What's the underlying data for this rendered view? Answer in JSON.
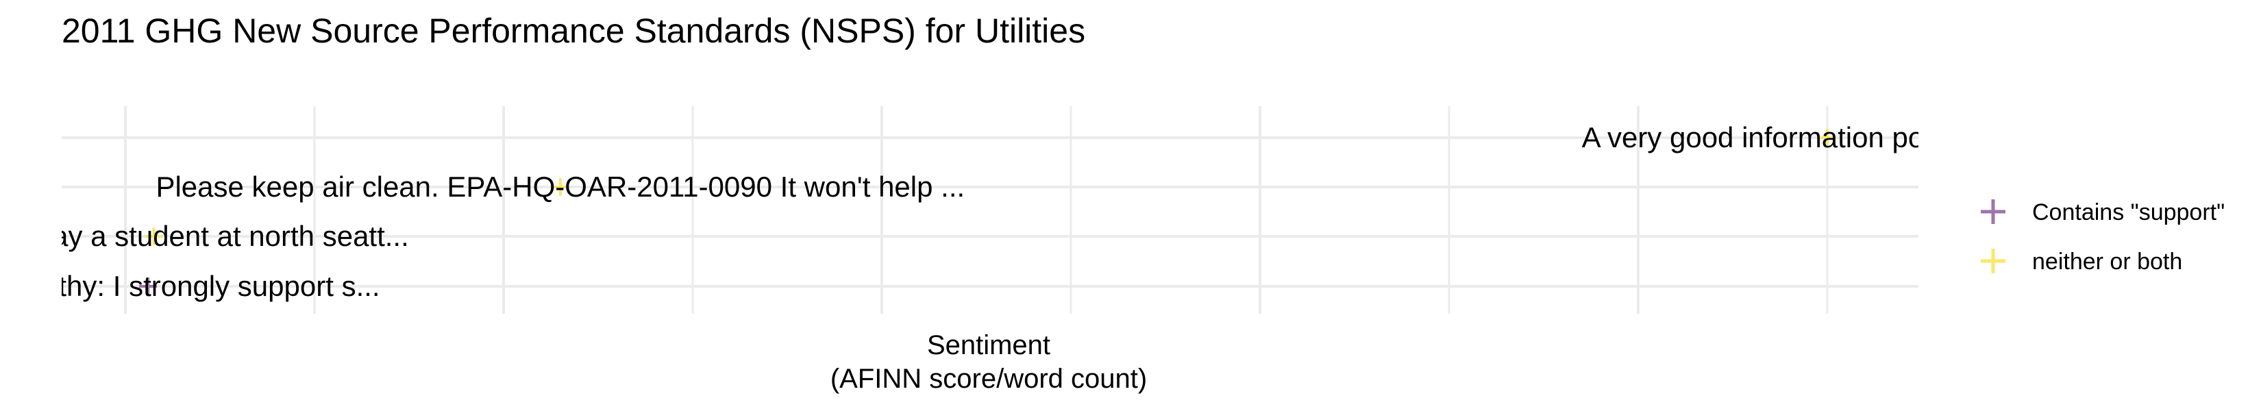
{
  "chart_data": {
    "type": "scatter",
    "title": "2011 GHG New Source Performance Standards (NSPS) for Utilities",
    "xlabel": "Sentiment",
    "xlabel_sub": "(AFINN score/word count)",
    "ylabel": "",
    "grid": true,
    "legend_position": "right",
    "series": [
      {
        "name": "Contains \"support\"",
        "color": "#9e75aa"
      },
      {
        "name": "neither or both",
        "color": "#f8e96a"
      }
    ],
    "points": [
      {
        "x": 0.9,
        "y": 4,
        "series": 1,
        "label": "A very good information posted and ve"
      },
      {
        "x": 0.23,
        "y": 3,
        "series": 1,
        "label": "Please keep air clean. EPA-HQ-OAR-2011-0090   It won't help ..."
      },
      {
        "x": 0.015,
        "y": 2,
        "series": 1,
        "label": "Collin Conway a student at north seatt..."
      },
      {
        "x": 0.012,
        "y": 1,
        "series": 0,
        "label": "ator McCarthy:  I strongly support s..."
      }
    ]
  }
}
